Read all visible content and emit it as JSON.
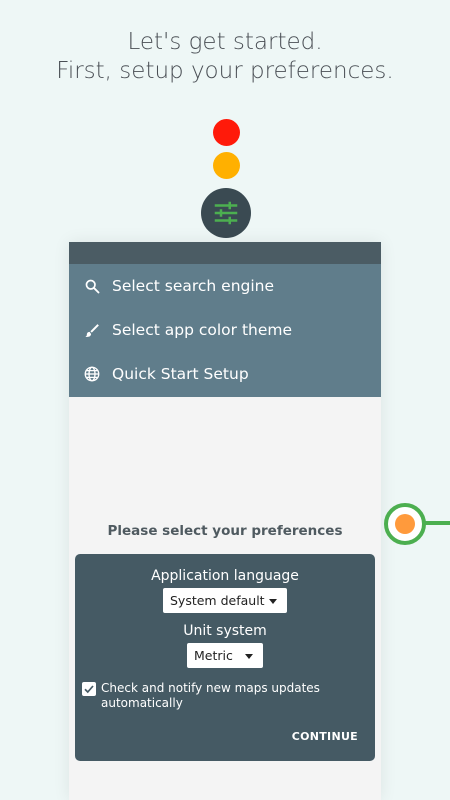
{
  "intro": {
    "line1": "Let's get started.",
    "line2": "First, setup your preferences."
  },
  "indicators": {
    "colors": {
      "red": "#ff1a0a",
      "amber": "#ffb000",
      "progress": "#4caf50",
      "progress_core": "#ff9a3c"
    },
    "center_icon": "sliders-icon"
  },
  "menu": {
    "items": [
      {
        "label": "Select search engine",
        "icon": "search-icon"
      },
      {
        "label": "Select app color theme",
        "icon": "brush-icon"
      },
      {
        "label": "Quick Start Setup",
        "icon": "globe-icon"
      }
    ]
  },
  "preferences": {
    "prompt": "Please select your preferences",
    "language_label": "Application language",
    "language_value": "System default",
    "unit_label": "Unit system",
    "unit_value": "Metric",
    "notify_checked": true,
    "notify_label": "Check and notify new maps updates automatically",
    "continue_label": "CONTINUE"
  },
  "colors": {
    "background": "#eef7f6",
    "menu_bg": "#607d8b",
    "card_bg": "#455a64"
  }
}
